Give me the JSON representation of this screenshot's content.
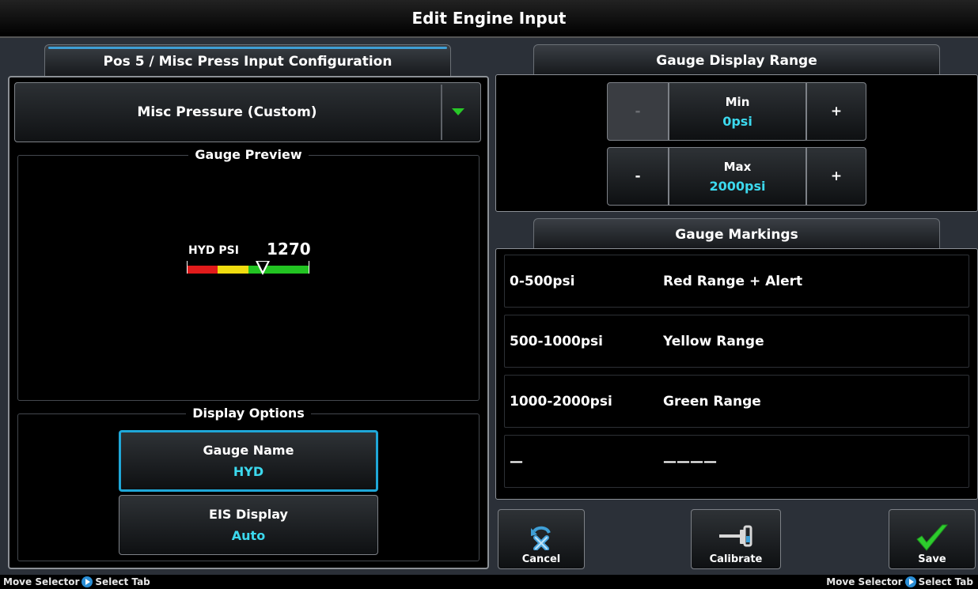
{
  "window": {
    "title": "Edit Engine Input"
  },
  "left_tab": {
    "label": "Pos 5 / Misc Press Input Configuration"
  },
  "input_type": {
    "value": "Misc Pressure (Custom)"
  },
  "gauge_preview": {
    "title": "Gauge Preview",
    "name": "HYD PSI",
    "value": "1270",
    "pointer_fraction": 0.635,
    "colors": {
      "red": "#e11b1b",
      "yellow": "#f0dc10",
      "green": "#22c322"
    }
  },
  "display_options": {
    "title": "Display Options",
    "gauge_name": {
      "label": "Gauge Name",
      "value": "HYD"
    },
    "eis_display": {
      "label": "EIS Display",
      "value": "Auto"
    }
  },
  "range_tab": {
    "label": "Gauge Display Range"
  },
  "range": {
    "min": {
      "label": "Min",
      "value": "0psi",
      "minus": "-",
      "plus": "+"
    },
    "max": {
      "label": "Max",
      "value": "2000psi",
      "minus": "-",
      "plus": "+"
    }
  },
  "markings_tab": {
    "label": "Gauge Markings"
  },
  "markings": [
    {
      "range": "0-500psi",
      "desc": "Red Range + Alert"
    },
    {
      "range": "500-1000psi",
      "desc": "Yellow Range"
    },
    {
      "range": "1000-2000psi",
      "desc": "Green Range"
    },
    {
      "range": "—",
      "desc": "————"
    }
  ],
  "actions": {
    "cancel": {
      "label": "Cancel",
      "icon": "cancel-icon"
    },
    "calibrate": {
      "label": "Calibrate",
      "icon": "calibrate-icon"
    },
    "save": {
      "label": "Save",
      "icon": "checkmark-icon"
    }
  },
  "status_bar": {
    "left": {
      "a": "Move Selector",
      "b": "Select Tab"
    },
    "right": {
      "a": "Move Selector",
      "b": "Select Tab"
    }
  },
  "accent": {
    "selection": "#1fa7d8",
    "value_text": "#3cd9ee",
    "tab_indicator": "#3f9fd6"
  }
}
